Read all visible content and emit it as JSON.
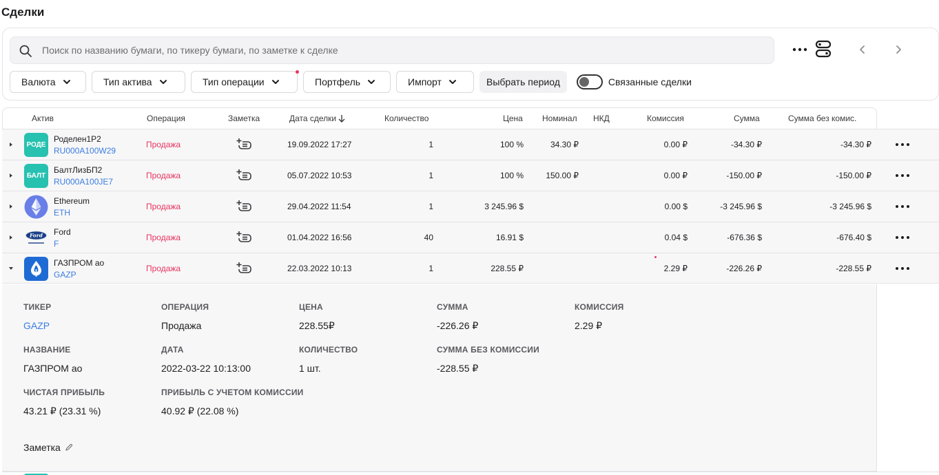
{
  "page": {
    "title": "Сделки"
  },
  "search": {
    "placeholder": "Поиск по названию бумаги, по тикеру бумаги, по заметке к сделке",
    "value": ""
  },
  "filters": {
    "currency": "Валюта",
    "asset_type": "Тип актива",
    "operation_type": "Тип операции",
    "portfolio": "Портфель",
    "import": "Импорт",
    "period": "Выбрать период",
    "linked_deals": "Связанные сделки"
  },
  "table": {
    "columns": {
      "asset": "Актив",
      "operation": "Операция",
      "note": "Заметка",
      "date": "Дата сделки",
      "quantity": "Количество",
      "price": "Цена",
      "nominal": "Номинал",
      "nkd": "НКД",
      "commission": "Комиссия",
      "sum": "Сумма",
      "sum_wo_commission": "Сумма без комис."
    },
    "rows": [
      {
        "logo_text": "РОДЕ",
        "logo_color": "#27c1b0",
        "name": "Роделен1Р2",
        "ticker": "RU000A100W29",
        "operation": "Продажа",
        "date": "19.09.2022 17:27",
        "quantity": "1",
        "price": "100 %",
        "nominal": "34.30 ₽",
        "nkd": "",
        "commission": "0.00 ₽",
        "sum": "-34.30 ₽",
        "sum_wo": "-34.30 ₽"
      },
      {
        "logo_text": "БАЛТ",
        "logo_color": "#27c1b0",
        "name": "БалтЛизБП2",
        "ticker": "RU000A100JE7",
        "operation": "Продажа",
        "date": "05.07.2022 10:53",
        "quantity": "1",
        "price": "100 %",
        "nominal": "150.00 ₽",
        "nkd": "",
        "commission": "0.00 ₽",
        "sum": "-150.00 ₽",
        "sum_wo": "-150.00 ₽"
      },
      {
        "logo_text": "",
        "logo_color": "#ffffff",
        "name": "Ethereum",
        "ticker": "ETH",
        "operation": "Продажа",
        "date": "29.04.2022 11:54",
        "quantity": "1",
        "price": "3 245.96 $",
        "nominal": "",
        "nkd": "",
        "commission": "0.00 $",
        "sum": "-3 245.96 $",
        "sum_wo": "-3 245.96 $"
      },
      {
        "logo_text": "Ford",
        "logo_color": "#ffffff",
        "name": "Ford",
        "ticker": "F",
        "operation": "Продажа",
        "date": "01.04.2022 16:56",
        "quantity": "40",
        "price": "16.91 $",
        "nominal": "",
        "nkd": "",
        "commission": "0.04 $",
        "sum": "-676.36 $",
        "sum_wo": "-676.40 $"
      },
      {
        "logo_text": "",
        "logo_color": "#1f6bd4",
        "name": "ГАЗПРОМ ао",
        "ticker": "GAZP",
        "operation": "Продажа",
        "date": "22.03.2022 10:13",
        "quantity": "1",
        "price": "228.55 ₽",
        "nominal": "",
        "nkd": "",
        "commission": "2.29 ₽",
        "sum": "-226.26 ₽",
        "sum_wo": "-228.55 ₽"
      }
    ]
  },
  "details": {
    "ticker_label": "ТИКЕР",
    "ticker": "GAZP",
    "operation_label": "ОПЕРАЦИЯ",
    "operation": "Продажа",
    "price_label": "ЦЕНА",
    "price": "228.55₽",
    "sum_label": "СУММА",
    "sum": "-226.26 ₽",
    "commission_label": "КОМИССИЯ",
    "commission": "2.29 ₽",
    "name_label": "НАЗВАНИЕ",
    "name": "ГАЗПРОМ ао",
    "date_label": "ДАТА",
    "date": "2022-03-22 10:13:00",
    "quantity_label": "КОЛИЧЕСТВО",
    "quantity": "1 шт.",
    "sum_wo_label": "СУММА БЕЗ КОМИССИИ",
    "sum_wo": "-228.55 ₽",
    "net_profit_label": "ЧИСТАЯ ПРИБЫЛЬ",
    "net_profit": "43.21 ₽ (23.31 %)",
    "profit_comm_label": "ПРИБЫЛЬ С УЧЕТОМ КОМИССИИ",
    "profit_comm": "40.92 ₽ (22.08 %)",
    "note_label": "Заметка"
  },
  "colors": {
    "accent_link": "#3b7de0",
    "sell": "#e8345e",
    "row_bg": "#f7f7f8",
    "border": "#e3e3e6"
  },
  "icons": [
    "search-icon",
    "more-horizontal-icon",
    "server-toggle-icon",
    "chevron-left-icon",
    "chevron-right-icon",
    "chevron-down-icon",
    "add-note-icon",
    "expand-arrow-icon",
    "pencil-icon"
  ]
}
